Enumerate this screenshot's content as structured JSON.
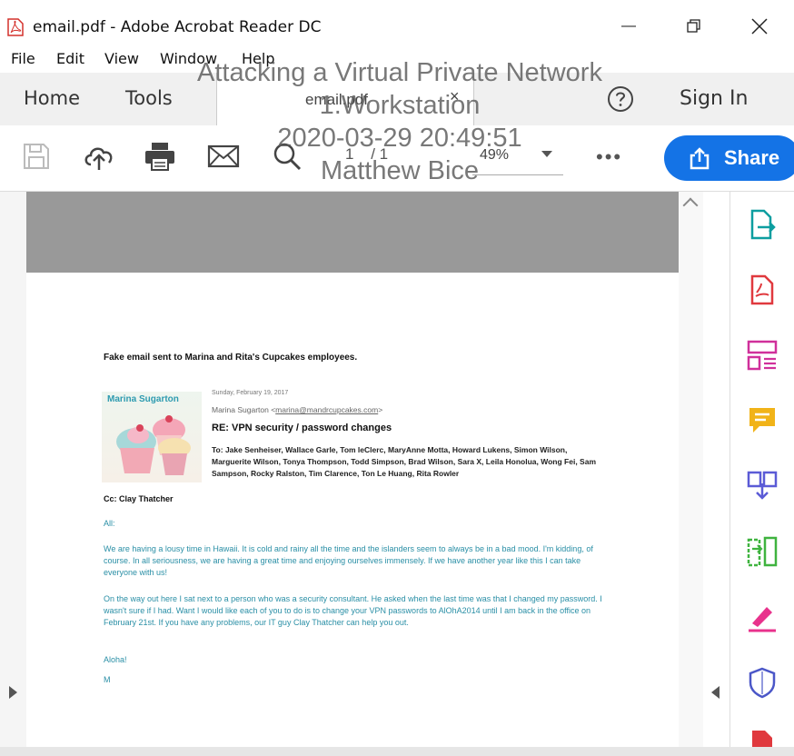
{
  "window": {
    "title": "email.pdf - Adobe Acrobat Reader DC",
    "minimize_glyph": "—",
    "restore_glyph": "❐",
    "close_glyph": "✕"
  },
  "menu": [
    "File",
    "Edit",
    "View",
    "Window",
    "Help"
  ],
  "tabs": {
    "home": "Home",
    "tools": "Tools",
    "document": "email.pdf",
    "close": "×",
    "sign_in": "Sign In"
  },
  "toolbar": {
    "page_current": "1",
    "page_total": "/ 1",
    "zoom": "49%",
    "more": "•••",
    "share": "Share"
  },
  "watermark": {
    "line1": "Attacking a Virtual Private Network",
    "line2": "1.Workstation",
    "line3": "2020-03-29 20:49:51",
    "line4": "Matthew Bice"
  },
  "pdf": {
    "caption": "Fake email sent to Marina and Rita's Cupcakes employees.",
    "image_name": "Marina Sugarton",
    "date": "Sunday, February 19, 2017",
    "from_name": "Marina Sugarton <",
    "from_email": "marina@mandrcupcakes.com",
    "from_end": ">",
    "subject": "RE: VPN security / password changes",
    "to": "To: Jake Senheiser, Wallace Garle, Tom leClerc, MaryAnne Motta, Howard Lukens, Simon Wilson, Marguerite Wilson, Tonya Thompson, Todd Simpson, Brad Wilson, Sara X, Leila Honolua, Wong Fei, Sam Sampson, Rocky Ralston, Tim Clarence, Ton Le Huang, Rita Rowler",
    "cc": "Cc: Clay Thatcher",
    "greeting": "All:",
    "p1": "We are having a lousy time in Hawaii. It is cold and rainy all the time and the islanders seem to always be in a bad mood. I'm kidding, of course. In all seriousness, we are having a great time and enjoying ourselves immensely. If we have another year like this I can take everyone with us!",
    "p2": "On the way out here I sat next to a person who was a security consultant. He asked when the last time was that I changed my password. I wasn't sure if I had. Want I would like each of you to do is to change your VPN passwords to AlOhA2014 until I am back in the office on February 21st. If you have any problems, our IT guy Clay Thatcher can help you out.",
    "closing": "Aloha!",
    "signature": "M"
  },
  "colors": {
    "accent": "#1473e6",
    "pdf_body_text": "#2a8fa6"
  }
}
